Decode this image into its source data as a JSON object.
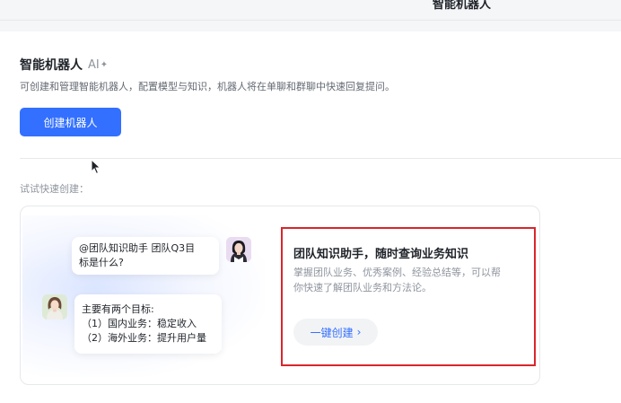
{
  "topbar": {
    "title": "智能机器人"
  },
  "header": {
    "title": "智能机器人",
    "ai_badge": "AI",
    "sparkle": "✦",
    "description": "可创建和管理智能机器人，配置模型与知识，机器人将在单聊和群聊中快速回复提问。"
  },
  "create_button": {
    "label": "创建机器人"
  },
  "quick_create": {
    "label": "试试快速创建："
  },
  "template": {
    "chat": {
      "question": [
        "@团队知识助手  团队Q3目",
        "标是什么?"
      ],
      "answer": [
        "主要有两个目标:",
        "（1）国内业务：稳定收入",
        "（2）海外业务：提升用户量"
      ]
    },
    "title": "团队知识助手，随时查询业务知识",
    "description": [
      "掌握团队业务、优秀案例、经验总结等，可以帮",
      "你快速了解团队业务和方法论。"
    ],
    "button_label": "一键创建",
    "button_icon": "›"
  },
  "colors": {
    "primary": "#3370ff",
    "highlight": "#d9262c",
    "text_primary": "#1f2329",
    "text_secondary": "#646a73",
    "text_tertiary": "#8f959e"
  }
}
